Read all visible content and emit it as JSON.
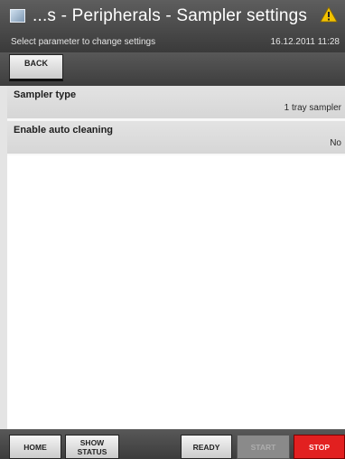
{
  "header": {
    "title": "...s - Peripherals - Sampler settings",
    "subtitle": "Select parameter to change settings",
    "datetime": "16.12.2011 11:28",
    "warning_icon": "warning-triangle-icon",
    "app_icon": "window-icon",
    "warning_color": "#f2c200"
  },
  "toolbar": {
    "back_label": "BACK"
  },
  "params": [
    {
      "label": "Sampler type",
      "value": "1 tray sampler"
    },
    {
      "label": "Enable auto cleaning",
      "value": "No"
    }
  ],
  "footer": {
    "home_label": "HOME",
    "show_status_line1": "SHOW",
    "show_status_line2": "STATUS",
    "ready_label": "READY",
    "start_label": "START",
    "stop_label": "STOP",
    "stop_color": "#e22020"
  }
}
